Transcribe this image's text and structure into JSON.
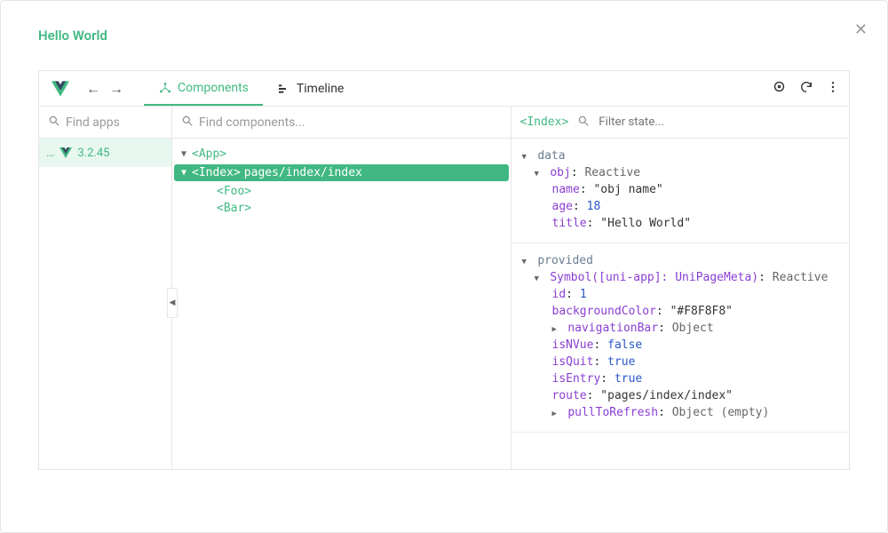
{
  "window": {
    "title": "Hello World"
  },
  "toolbar": {
    "tabs": {
      "components": "Components",
      "timeline": "Timeline"
    }
  },
  "search": {
    "apps_placeholder": "Find apps",
    "components_placeholder": "Find components...",
    "state_placeholder": "Filter state..."
  },
  "apps": {
    "ellipsis": "…",
    "version": "3.2.45"
  },
  "tree": {
    "root": "<App>",
    "selected_tag": "<Index>",
    "selected_path": "pages/index/index",
    "foo": "<Foo>",
    "bar": "<Bar>",
    "selected_header": "<Index>"
  },
  "state": {
    "data_label": "data",
    "provided_label": "provided",
    "obj_key": "obj",
    "reactive": "Reactive",
    "name_key": "name",
    "name_val": "\"obj name\"",
    "age_key": "age",
    "age_val": "18",
    "title_key": "title",
    "title_val": "\"Hello World\"",
    "symbol_key": "Symbol([uni-app]: UniPageMeta)",
    "id_key": "id",
    "id_val": "1",
    "bg_key": "backgroundColor",
    "bg_val": "\"#F8F8F8\"",
    "navbar_key": "navigationBar",
    "object_label": "Object",
    "isnvue_key": "isNVue",
    "false_val": "false",
    "isquit_key": "isQuit",
    "true_val": "true",
    "isentry_key": "isEntry",
    "route_key": "route",
    "route_val": "\"pages/index/index\"",
    "pull_key": "pullToRefresh",
    "object_empty": "Object (empty)"
  }
}
